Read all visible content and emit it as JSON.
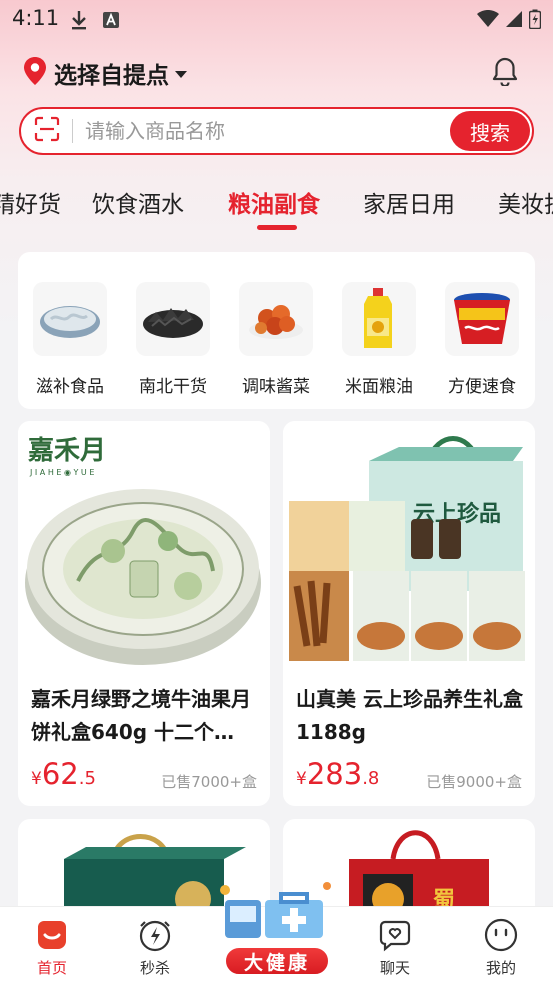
{
  "status_bar": {
    "time": "4:11"
  },
  "header": {
    "location": "选择自提点"
  },
  "search": {
    "placeholder": "请输入商品名称",
    "button": "搜索"
  },
  "tabs": [
    {
      "label": "精好货"
    },
    {
      "label": "饮食酒水"
    },
    {
      "label": "粮油副食",
      "active": true
    },
    {
      "label": "家居日用"
    },
    {
      "label": "美妆护"
    }
  ],
  "subcategories": [
    {
      "label": "滋补食品"
    },
    {
      "label": "南北干货"
    },
    {
      "label": "调味酱菜"
    },
    {
      "label": "米面粮油"
    },
    {
      "label": "方便速食"
    }
  ],
  "products": [
    {
      "title": "嘉禾月绿野之境牛油果月饼礼盒640g 十二个装",
      "title_display": "嘉禾月绿野之境牛油果月饼礼盒640g 十二个…",
      "price_currency": "¥",
      "price_int": "62",
      "price_dec": ".5",
      "sold": "已售7000+盒",
      "brand": "嘉禾月",
      "brand_sub": "J I A H E ◉ Y U E"
    },
    {
      "title": "山真美 云上珍品养生礼盒1188g",
      "price_currency": "¥",
      "price_int": "283",
      "price_dec": ".8",
      "sold": "已售9000+盒",
      "box_text": "云上珍品"
    }
  ],
  "bottom_nav": [
    {
      "label": "首页",
      "active": true
    },
    {
      "label": "秒杀"
    },
    {
      "label": "大健康"
    },
    {
      "label": "聊天"
    },
    {
      "label": "我的"
    }
  ],
  "colors": {
    "accent": "#e5232e",
    "brand_green": "#2f6b3a"
  }
}
